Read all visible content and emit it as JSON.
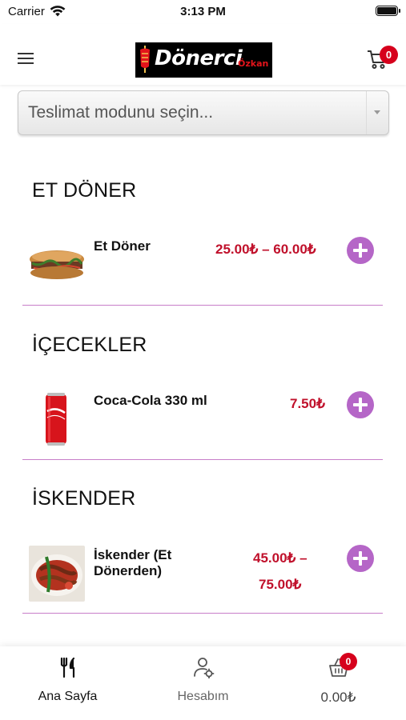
{
  "status_bar": {
    "carrier": "Carrier",
    "time": "3:13 PM",
    "icons": [
      "wifi-icon",
      "battery-icon"
    ]
  },
  "header": {
    "logo_text": "Dönerci",
    "logo_subtext": "Özkan",
    "menu_icon": "hamburger-icon",
    "cart_icon": "cart-icon",
    "cart_count": "0"
  },
  "delivery": {
    "placeholder": "Teslimat modunu seçin..."
  },
  "sections": [
    {
      "title": "ET DÖNER",
      "products": [
        {
          "name": "Et Döner",
          "price_line1": "25.00₺ – 60.00₺",
          "price_line2": ""
        }
      ]
    },
    {
      "title": "İÇECEKLER",
      "products": [
        {
          "name": "Coca-Cola 330 ml",
          "price_line1": "7.50₺",
          "price_line2": ""
        }
      ]
    },
    {
      "title": "İSKENDER",
      "products": [
        {
          "name": "İskender (Et Dönerden)",
          "price_line1": "45.00₺ –",
          "price_line2": "75.00₺"
        }
      ]
    }
  ],
  "tabbar": {
    "home_label": "Ana Sayfa",
    "account_label": "Hesabım",
    "basket_total": "0.00₺",
    "basket_count": "0"
  },
  "colors": {
    "accent_purple": "#b566c7",
    "price_red": "#c0102b",
    "badge_red": "#d6001c",
    "divider": "#c77dc9"
  }
}
